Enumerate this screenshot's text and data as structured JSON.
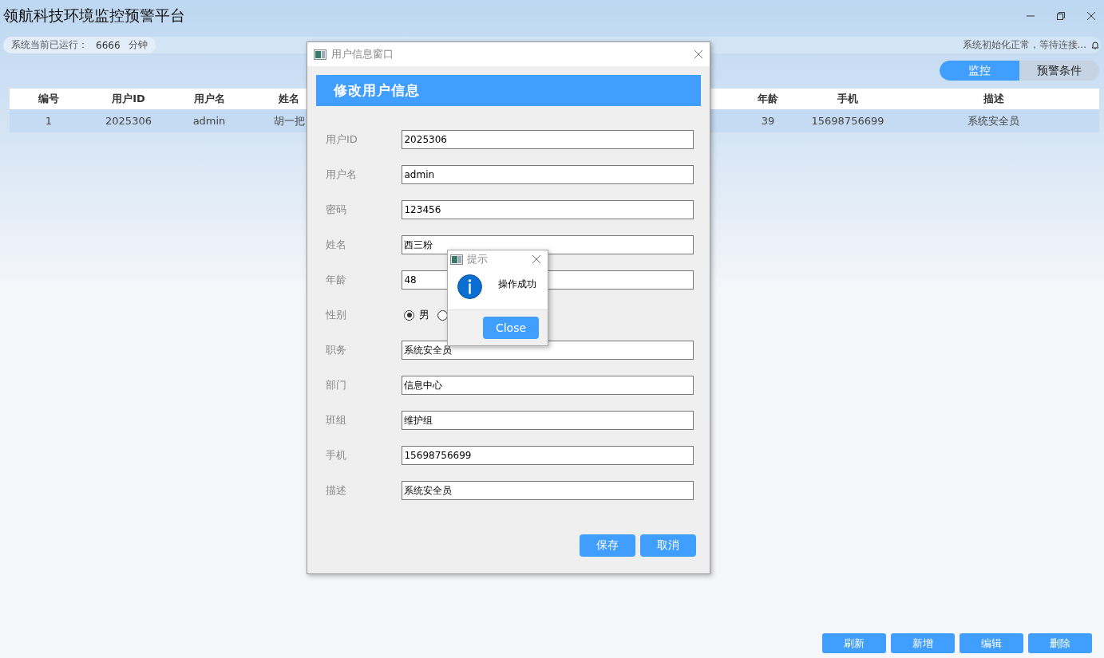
{
  "window": {
    "title": "领航科技环境监控预警平台"
  },
  "status": {
    "uptime_label": "系统当前已运行：",
    "uptime_value": "6666",
    "uptime_unit": "分钟",
    "message": "系统初始化正常，等待连接..."
  },
  "tabs": [
    {
      "label": "监控",
      "selected": true
    },
    {
      "label": "预警条件",
      "selected": false
    }
  ],
  "table": {
    "columns": [
      "编号",
      "用户ID",
      "用户名",
      "姓名",
      "年龄",
      "手机",
      "描述"
    ],
    "rows": [
      {
        "selected": true,
        "cells": [
          "1",
          "2025306",
          "admin",
          "胡一把",
          "39",
          "15698756699",
          "系统安全员"
        ]
      }
    ]
  },
  "actions": [
    "刷新",
    "新增",
    "编辑",
    "删除"
  ],
  "dialog": {
    "title": "用户信息窗口",
    "heading": "修改用户信息",
    "fields": [
      {
        "kind": "text",
        "label": "用户ID",
        "value": "2025306"
      },
      {
        "kind": "text",
        "label": "用户名",
        "value": "admin"
      },
      {
        "kind": "text",
        "label": "密码",
        "value": "123456"
      },
      {
        "kind": "text",
        "label": "姓名",
        "value": "西三粉"
      },
      {
        "kind": "text",
        "label": "年龄",
        "value": "48"
      },
      {
        "kind": "radio",
        "label": "性别",
        "options": [
          {
            "label": "男",
            "selected": true
          },
          {
            "selected": false
          }
        ]
      },
      {
        "kind": "text",
        "label": "职务",
        "value": "系统安全员"
      },
      {
        "kind": "text",
        "label": "部门",
        "value": "信息中心"
      },
      {
        "kind": "text",
        "label": "班组",
        "value": "维护组"
      },
      {
        "kind": "text",
        "label": "手机",
        "value": "15698756699"
      },
      {
        "kind": "text",
        "label": "描述",
        "value": "系统安全员"
      }
    ],
    "buttons": [
      "保存",
      "取消"
    ]
  },
  "message_box": {
    "title": "提示",
    "message": "操作成功",
    "button": "Close"
  }
}
